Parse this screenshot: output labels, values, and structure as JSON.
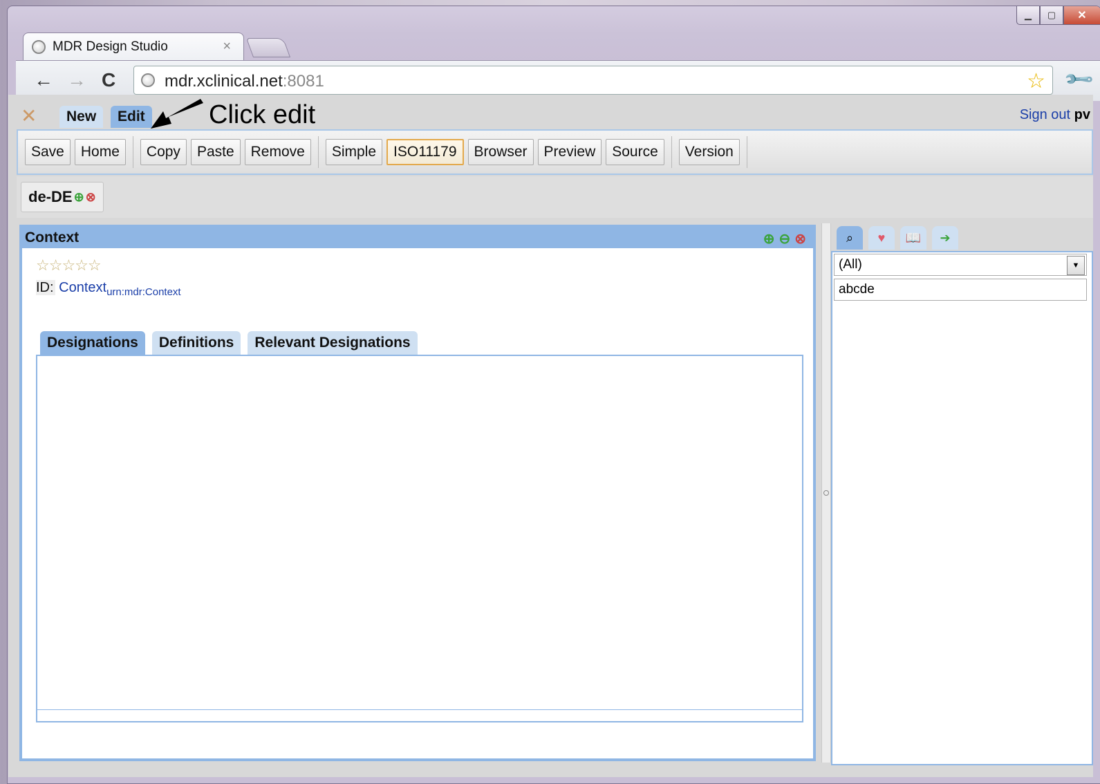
{
  "browser": {
    "tab_title": "MDR Design Studio",
    "tab_close": "×",
    "url_host": "mdr.xclinical.net",
    "url_port": ":8081"
  },
  "app": {
    "tabs": [
      "New",
      "Edit"
    ],
    "annotation": "Click edit",
    "signout": "Sign out",
    "user": "pv"
  },
  "toolbar": {
    "groups": [
      [
        "Save",
        "Home"
      ],
      [
        "Copy",
        "Paste",
        "Remove"
      ],
      [
        "Simple",
        "ISO11179",
        "Browser",
        "Preview",
        "Source"
      ],
      [
        "Version"
      ]
    ],
    "active": "ISO11179"
  },
  "language": {
    "code": "de-DE"
  },
  "context_panel": {
    "title": "Context",
    "stars": "☆☆☆☆☆",
    "id_label": "ID:",
    "id_value": "Context",
    "id_urn": "urn:mdr:Context",
    "tabs": [
      "Designations",
      "Definitions",
      "Relevant Designations"
    ]
  },
  "right_panel": {
    "tab_icons": [
      "binoculars-icon",
      "heart-icon",
      "book-icon",
      "export-icon"
    ],
    "filter_value": "(All)",
    "search_value": "abcde"
  },
  "colors": {
    "panel_blue": "#8fb6e4",
    "light_tab": "#cfe0f2",
    "active_button_border": "#e3a94c",
    "link": "#1a3ea8"
  }
}
